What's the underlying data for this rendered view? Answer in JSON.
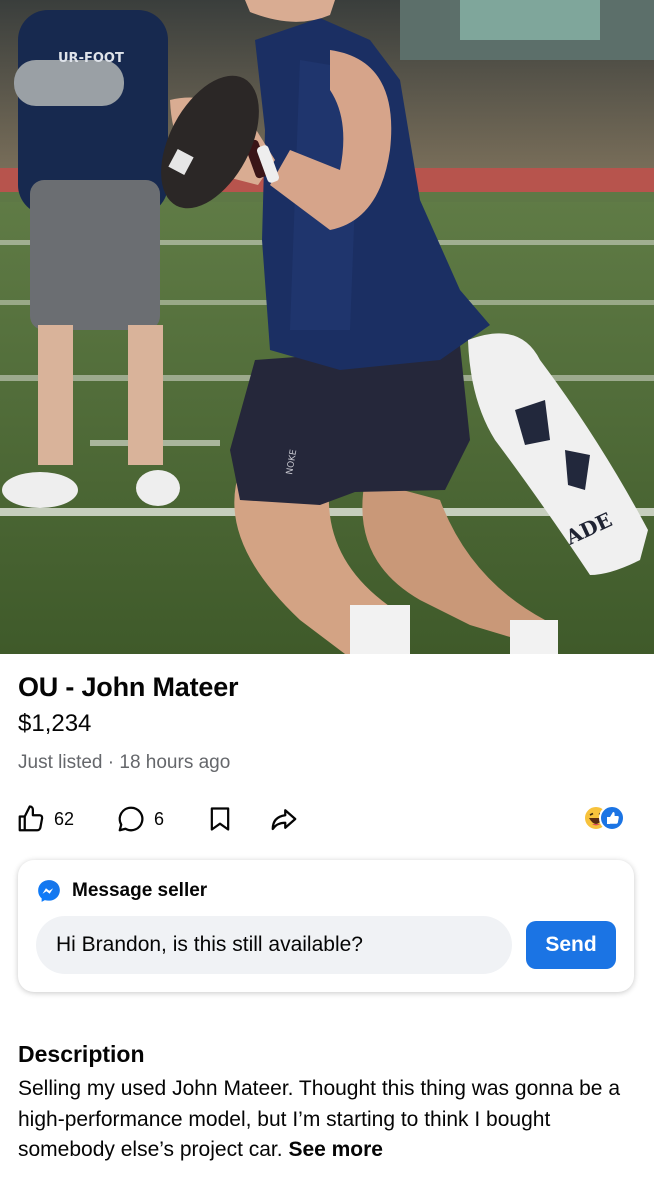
{
  "listing": {
    "title": "OU - John Mateer",
    "price": "$1,234",
    "listed_label": "Just listed",
    "separator": "·",
    "time_ago": "18 hours ago"
  },
  "actions": {
    "like_count": "62",
    "comment_count": "6",
    "icons": [
      "thumbs-up-icon",
      "comment-icon",
      "bookmark-icon",
      "share-icon"
    ],
    "reaction_icons": [
      "haha-reaction-icon",
      "like-reaction-icon"
    ]
  },
  "message_card": {
    "header": "Message seller",
    "input_value": "Hi Brandon, is this still available?",
    "send_label": "Send"
  },
  "description": {
    "heading": "Description",
    "text": "Selling my used John Mateer. Thought this thing was gonna be a high-performance model, but I’m starting to think I bought somebody else’s project car.",
    "see_more": "See more"
  },
  "photo": {
    "shirt_text": "UR-FOOT",
    "towel_text": "ADE",
    "shorts_text": "NOKE"
  },
  "colors": {
    "accent": "#1b74e4",
    "muted_text": "#65676b",
    "input_bg": "#f0f2f5"
  }
}
